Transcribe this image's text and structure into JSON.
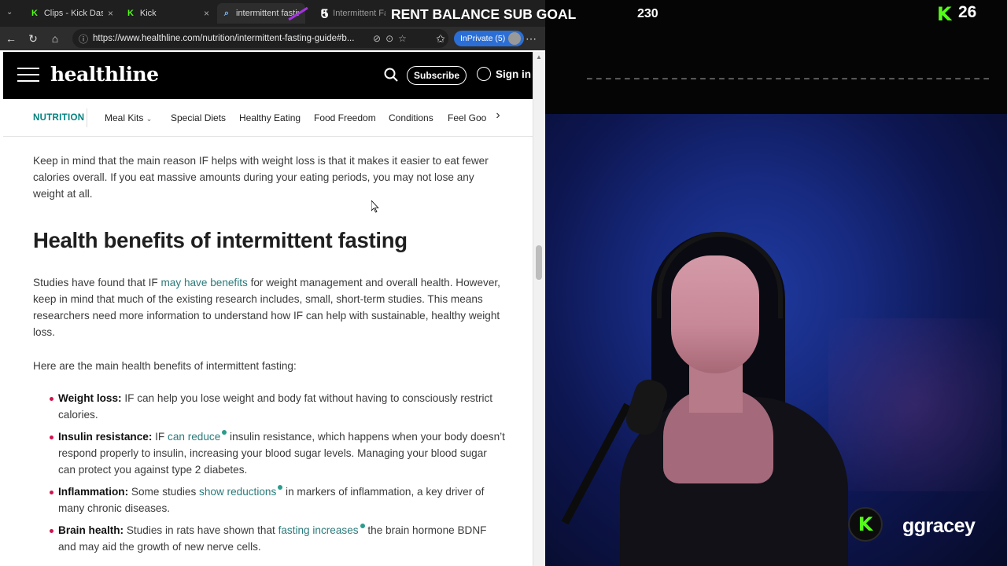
{
  "browser": {
    "tabs": [
      {
        "title": "Clips - Kick Dashb",
        "active": false
      },
      {
        "title": "Kick",
        "active": false
      },
      {
        "title": "intermittent fastin",
        "active": true
      },
      {
        "title": "Intermittent Fast",
        "active": false
      }
    ],
    "url": "https://www.healthline.com/nutrition/intermittent-fasting-guide#b...",
    "inprivate_label": "InPrivate (5)"
  },
  "site": {
    "logo": "healthline",
    "subscribe_label": "Subscribe",
    "signin_label": "Sign in",
    "nav": {
      "section": "NUTRITION",
      "items": [
        "Meal Kits",
        "Special Diets",
        "Healthy Eating",
        "Food Freedom",
        "Conditions",
        "Feel Goo"
      ]
    }
  },
  "article": {
    "intro_p": "Keep in mind that the main reason IF helps with weight loss is that it makes it easier to eat fewer calories overall. If you eat massive amounts during your eating periods, you may not lose any weight at all.",
    "heading": "Health benefits of intermittent fasting",
    "p1_a": "Studies have found that IF ",
    "p1_link": "may have benefits",
    "p1_b": " for weight management and overall health. However, keep in mind that much of the existing research includes, small, short-term studies. This means researchers need more information to understand how IF can help with sustainable, healthy weight loss.",
    "p2": "Here are the main health benefits of intermittent fasting:",
    "bullets": [
      {
        "label": "Weight loss:",
        "pre": " IF can help you lose weight and body fat without having to consciously restrict calories.",
        "link": "",
        "post": ""
      },
      {
        "label": "Insulin resistance:",
        "pre": " IF ",
        "link": "can reduce",
        "post": " insulin resistance, which happens when your body doesn’t respond properly to insulin, increasing your blood sugar levels. Managing your blood sugar can protect you against type 2 diabetes."
      },
      {
        "label": "Inflammation:",
        "pre": " Some studies ",
        "link": "show reductions",
        "post": " in markers of inflammation, a key driver of many chronic diseases."
      },
      {
        "label": "Brain health:",
        "pre": " Studies in rats have shown that ",
        "link": "fasting increases",
        "post": " the brain hormone BDNF and may aid the growth of new nerve cells."
      }
    ]
  },
  "overlay": {
    "goal_prefix": "5",
    "goal_title": "RENT BALANCE SUB GOAL",
    "goal_count": "230",
    "kick_count": "26",
    "streamer_name": "ggracey",
    "kick_letter": "K",
    "accent": "#53fc18"
  }
}
